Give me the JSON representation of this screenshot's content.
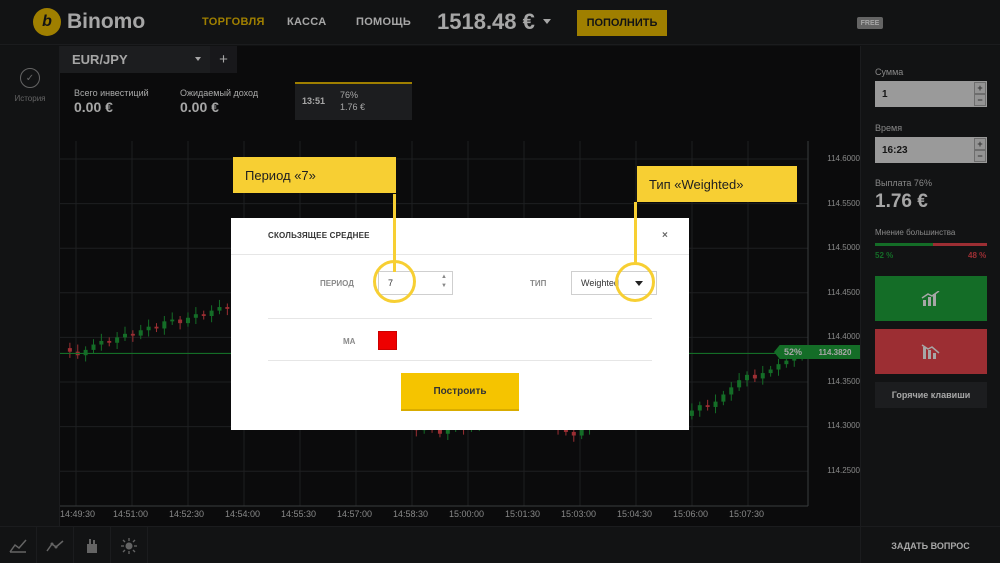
{
  "brand": {
    "name": "Binomo",
    "badge": "b"
  },
  "nav": {
    "trade": "ТОРГОВЛЯ",
    "cashier": "КАССА",
    "help": "ПОМОЩЬ"
  },
  "account": {
    "balance": "1518.48 €",
    "deposit_label": "ПОПОЛНИТЬ",
    "free_badge": "FREE"
  },
  "sidebar": {
    "history_label": "История"
  },
  "asset": {
    "name": "EUR/JPY",
    "add_label": "+"
  },
  "stats": {
    "total_invest_label": "Всего инвестиций",
    "total_invest_value": "0.00 €",
    "expected_income_label": "Ожидаемый доход",
    "expected_income_value": "0.00 €"
  },
  "trade_card": {
    "time": "13:51",
    "percent": "76%",
    "value": "1.76 €"
  },
  "chart_data": {
    "type": "candlestick",
    "price_ticks": [
      "114.6000",
      "114.5500",
      "114.5000",
      "114.4500",
      "114.4000",
      "114.3500",
      "114.3000",
      "114.2500"
    ],
    "time_ticks": [
      "14:49:30",
      "14:51:00",
      "14:52:30",
      "14:54:00",
      "14:55:30",
      "14:57:00",
      "14:58:30",
      "15:00:00",
      "15:01:30",
      "15:03:00",
      "15:04:30",
      "15:06:00",
      "15:07:30"
    ],
    "current_price": "114.3820",
    "current_percent": "52%",
    "colors": {
      "up": "#1fa83c",
      "down": "#f0484f"
    },
    "candles": [
      114.388,
      114.384,
      114.38,
      114.386,
      114.392,
      114.396,
      114.394,
      114.4,
      114.404,
      114.402,
      114.408,
      114.412,
      114.41,
      114.418,
      114.42,
      114.416,
      114.422,
      114.426,
      114.424,
      114.43,
      114.434,
      114.432,
      114.436,
      114.44,
      114.438,
      114.442,
      114.436,
      114.432,
      114.438,
      114.444,
      114.446,
      114.442,
      114.44,
      114.436,
      114.43,
      114.422,
      114.41,
      114.398,
      114.386,
      114.372,
      114.356,
      114.34,
      114.326,
      114.312,
      114.302,
      114.296,
      114.304,
      114.3,
      114.292,
      114.298,
      114.304,
      114.298,
      114.302,
      114.31,
      114.306,
      114.314,
      114.32,
      114.316,
      114.322,
      114.326,
      114.32,
      114.312,
      114.304,
      114.298,
      114.294,
      114.29,
      114.298,
      114.302,
      114.308,
      114.318,
      114.33,
      114.34,
      114.35,
      114.356,
      114.346,
      114.336,
      114.328,
      114.322,
      114.316,
      114.312,
      114.318,
      114.324,
      114.322,
      114.328,
      114.336,
      114.344,
      114.352,
      114.358,
      114.354,
      114.36,
      114.364,
      114.37,
      114.374,
      114.378,
      114.382
    ]
  },
  "right_panel": {
    "amount_label": "Сумма",
    "amount_value": "1",
    "time_label": "Время",
    "time_value": "16:23",
    "payout_label": "Выплата 76%",
    "payout_value": "1.76 €",
    "majority_label": "Мнение большинства",
    "majority_up": "52 %",
    "majority_down": "48 %",
    "majority_up_fraction": 0.52,
    "hotkeys_label": "Горячие клавиши",
    "step_plus": "+",
    "step_minus": "−"
  },
  "bottom": {
    "ask_label": "ЗАДАТЬ ВОПРОС"
  },
  "modal": {
    "title": "СКОЛЬЗЯЩЕЕ СРЕДНЕЕ",
    "close": "×",
    "period_label": "ПЕРИОД",
    "period_value": "7",
    "type_label": "ТИП",
    "type_value": "Weighted",
    "ma_label": "MA",
    "ma_color": "#ee0000",
    "build_label": "Построить"
  },
  "callouts": {
    "period": "Период «7»",
    "type": "Тип «Weighted»"
  }
}
